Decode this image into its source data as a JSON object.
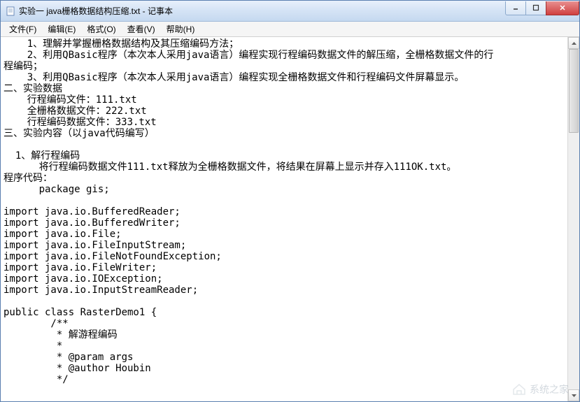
{
  "window": {
    "title": "实验一 java栅格数据结构压缩.txt - 记事本"
  },
  "menu": {
    "file": "文件(F)",
    "edit": "编辑(E)",
    "format": "格式(O)",
    "view": "查看(V)",
    "help": "帮助(H)"
  },
  "content": {
    "text": "    1、理解并掌握栅格数据结构及其压缩编码方法；\n    2、利用QBasic程序（本次本人采用java语言）编程实现行程编码数据文件的解压缩，全栅格数据文件的行\n程编码；\n    3、利用QBasic程序（本次本人采用java语言）编程实现全栅格数据文件和行程编码文件屏幕显示。\n二、实验数据\n    行程编码文件：111.txt\n    全栅格数据文件：222.txt\n    行程编码数据文件：333.txt\n三、实验内容（以java代码编写）\n\n  1、解行程编码\n      将行程编码数据文件111.txt释放为全栅格数据文件，将结果在屏幕上显示并存入111OK.txt。\n程序代码：\n      package gis;\n\nimport java.io.BufferedReader;\nimport java.io.BufferedWriter;\nimport java.io.File;\nimport java.io.FileInputStream;\nimport java.io.FileNotFoundException;\nimport java.io.FileWriter;\nimport java.io.IOException;\nimport java.io.InputStreamReader;\n\npublic class RasterDemo1 {\n        /**\n         * 解游程编码\n         * \n         * @param args\n         * @author Houbin\n         */"
  },
  "watermark": {
    "text": "系统之家"
  }
}
